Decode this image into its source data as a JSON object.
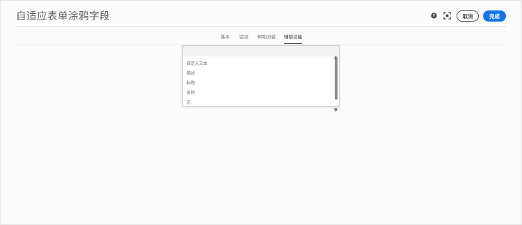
{
  "header": {
    "title": "自适应表单涂鸦字段",
    "help_icon": "help-circle-icon",
    "expand_icon": "fullscreen-icon",
    "cancel_label": "取消",
    "done_label": "完成",
    "accent_color": "#1473e6"
  },
  "tabs": [
    {
      "label": "基本",
      "active": false
    },
    {
      "label": "验证",
      "active": false
    },
    {
      "label": "帮助内容",
      "active": false
    },
    {
      "label": "辅助功能",
      "active": true
    }
  ],
  "dropdown": {
    "selected_value": "",
    "options": [
      "自定义文本",
      "描述",
      "标题",
      "名称",
      "无"
    ]
  },
  "scrollbar": {
    "up_icon": "scroll-up-arrow-icon",
    "down_icon": "scroll-down-arrow-icon"
  }
}
